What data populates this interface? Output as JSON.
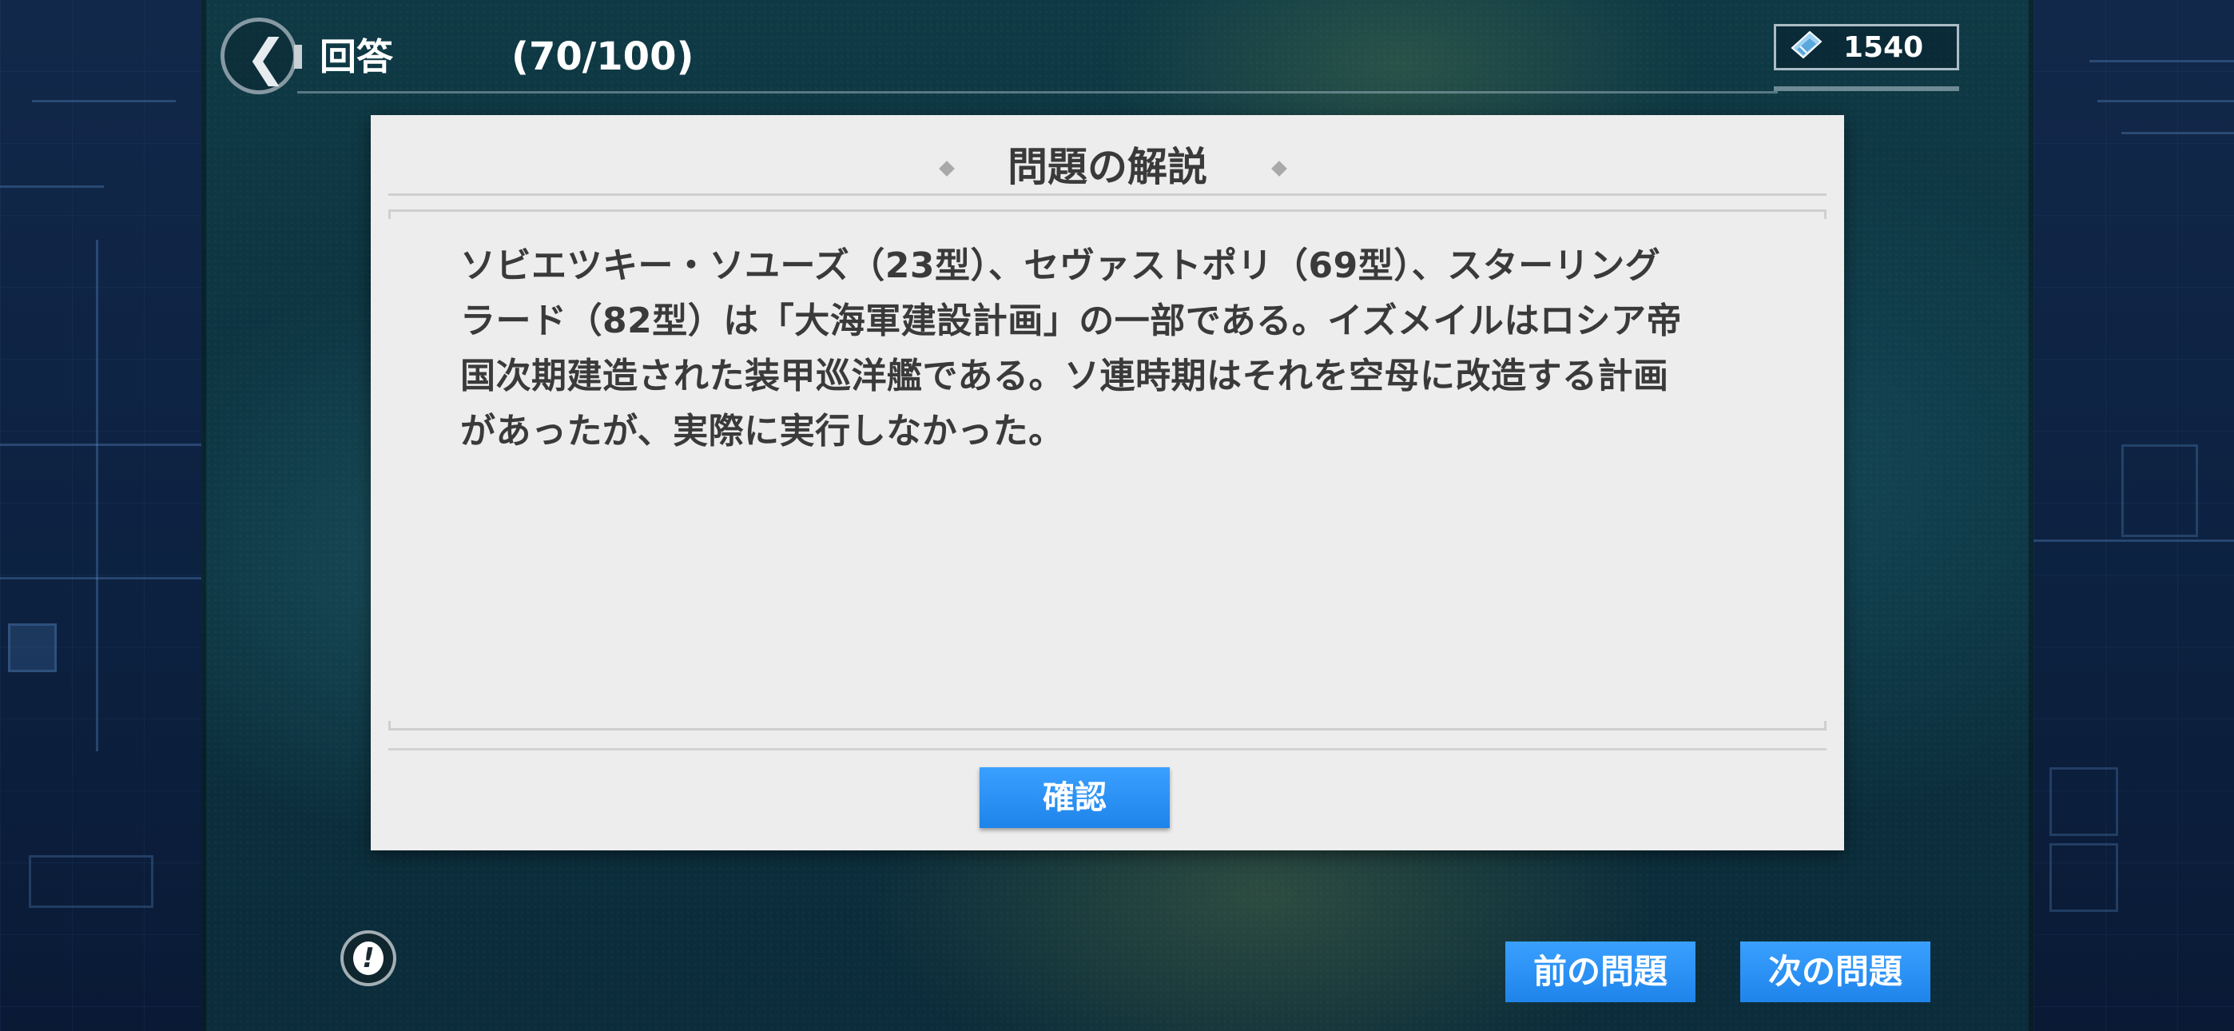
{
  "header": {
    "back_icon": "chevron-left-icon",
    "title": "回答",
    "progress": "(70/100)",
    "currency": {
      "icon": "ticket-icon",
      "amount": "1540"
    }
  },
  "dialog": {
    "title": "問題の解説",
    "explanation_lines": [
      "ソビエツキー・ソユーズ（23型）、セヴァストポリ（69型）、スターリング",
      "ラード（82型）は「大海軍建設計画」の一部である。イズメイルはロシア帝",
      "国次期建造された装甲巡洋艦である。ソ連時期はそれを空母に改造する計画",
      "があったが、実際に実行しなかった。"
    ],
    "confirm_label": "確認"
  },
  "footer": {
    "report_icon": "exclamation-icon",
    "report_mark": "!",
    "prev_label": "前の問題",
    "next_label": "次の問題"
  },
  "colors": {
    "button_blue": "#2a92f5",
    "dialog_bg": "#ededed",
    "text_dark": "#3a3a3a",
    "side_panel": "#0f2444",
    "scene": "#0d3442"
  }
}
